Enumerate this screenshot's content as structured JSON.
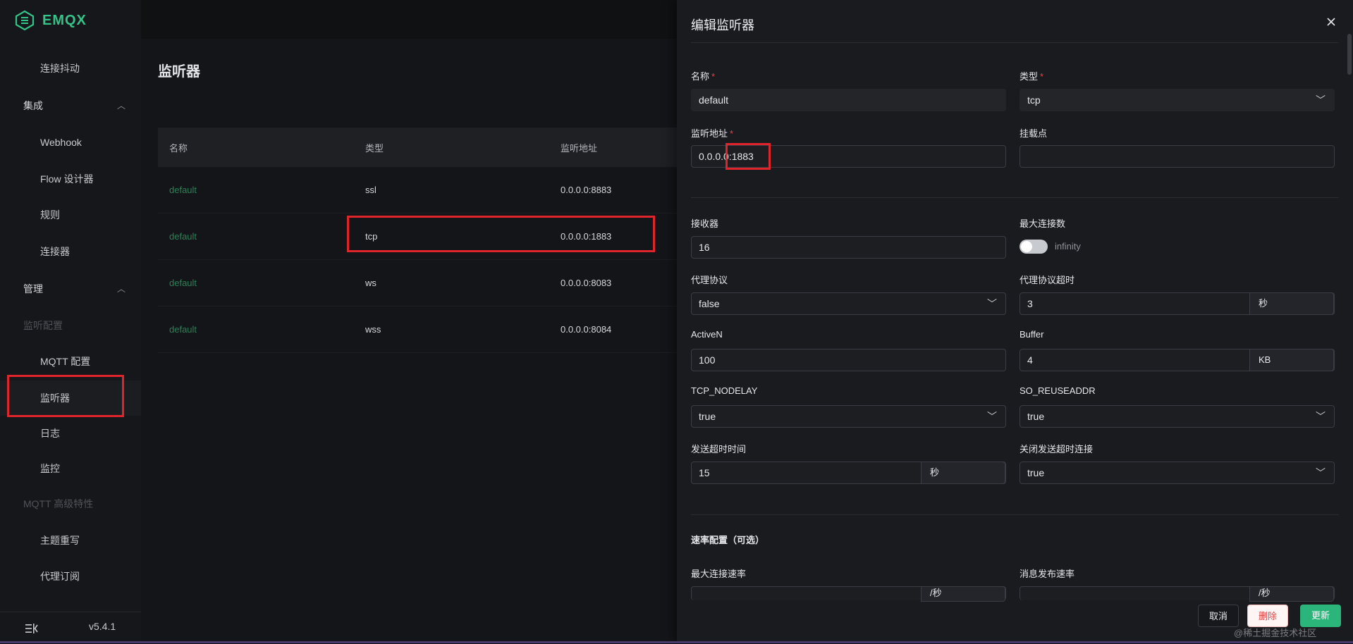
{
  "app": {
    "logo_text": "EMQX",
    "version": "v5.4.1"
  },
  "sidebar": {
    "items": [
      {
        "label": "连接抖动",
        "kind": "sub"
      },
      {
        "label": "集成",
        "kind": "group",
        "expanded": true
      },
      {
        "label": "Webhook",
        "kind": "sub"
      },
      {
        "label": "Flow 设计器",
        "kind": "sub"
      },
      {
        "label": "规则",
        "kind": "sub"
      },
      {
        "label": "连接器",
        "kind": "sub"
      },
      {
        "label": "管理",
        "kind": "group",
        "expanded": true
      },
      {
        "label": "监听配置",
        "kind": "category"
      },
      {
        "label": "MQTT 配置",
        "kind": "sub"
      },
      {
        "label": "监听器",
        "kind": "sub",
        "active": true
      },
      {
        "label": "日志",
        "kind": "sub"
      },
      {
        "label": "监控",
        "kind": "sub"
      },
      {
        "label": "MQTT 高级特性",
        "kind": "category"
      },
      {
        "label": "主题重写",
        "kind": "sub"
      },
      {
        "label": "代理订阅",
        "kind": "sub"
      }
    ]
  },
  "main": {
    "title": "监听器",
    "table": {
      "headers": [
        "名称",
        "类型",
        "监听地址"
      ],
      "rows": [
        {
          "name": "default",
          "type": "ssl",
          "address": "0.0.0.0:8883"
        },
        {
          "name": "default",
          "type": "tcp",
          "address": "0.0.0.0:1883"
        },
        {
          "name": "default",
          "type": "ws",
          "address": "0.0.0.0:8083"
        },
        {
          "name": "default",
          "type": "wss",
          "address": "0.0.0.0:8084"
        }
      ]
    }
  },
  "drawer": {
    "title": "编辑监听器",
    "fields": {
      "name": {
        "label": "名称",
        "value": "default"
      },
      "type": {
        "label": "类型",
        "value": "tcp"
      },
      "bind": {
        "label": "监听地址",
        "value": "0.0.0.0:1883"
      },
      "mountpoint": {
        "label": "挂载点",
        "value": ""
      },
      "acceptors": {
        "label": "接收器",
        "value": "16"
      },
      "max_connections": {
        "label": "最大连接数",
        "value": "infinity",
        "toggle_on": false
      },
      "proxy_protocol": {
        "label": "代理协议",
        "value": "false"
      },
      "proxy_protocol_timeout": {
        "label": "代理协议超时",
        "value": "3",
        "unit": "秒"
      },
      "active_n": {
        "label": "ActiveN",
        "value": "100"
      },
      "buffer": {
        "label": "Buffer",
        "value": "4",
        "unit": "KB"
      },
      "nodelay": {
        "label": "TCP_NODELAY",
        "value": "true"
      },
      "reuseaddr": {
        "label": "SO_REUSEADDR",
        "value": "true"
      },
      "send_timeout": {
        "label": "发送超时时间",
        "value": "15",
        "unit": "秒"
      },
      "send_timeout_close": {
        "label": "关闭发送超时连接",
        "value": "true"
      }
    },
    "rate_section": {
      "title": "速率配置（可选）",
      "max_conn_rate": {
        "label": "最大连接速率",
        "unit": "/秒"
      },
      "messages_rate": {
        "label": "消息发布速率",
        "unit": "/秒"
      }
    },
    "buttons": {
      "cancel": "取消",
      "delete": "删除",
      "update": "更新"
    }
  },
  "watermark": "@稀土掘金技术社区",
  "colors": {
    "accent": "#34c388",
    "highlight": "#e0242b",
    "link": "#2e8058"
  }
}
